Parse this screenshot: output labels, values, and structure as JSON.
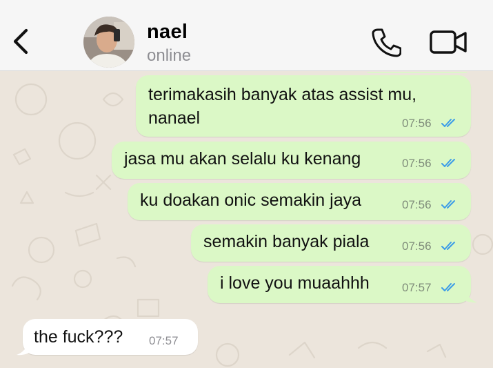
{
  "header": {
    "contact_name": "nael",
    "contact_status": "online",
    "back_icon": "chevron-left-icon",
    "call_icon": "phone-icon",
    "video_icon": "video-camera-icon"
  },
  "colors": {
    "header_bg": "#f6f6f6",
    "chat_bg": "#ece5dc",
    "outgoing_bubble": "#dbf8c6",
    "incoming_bubble": "#ffffff",
    "read_ticks": "#3a9be8"
  },
  "messages": [
    {
      "direction": "outgoing",
      "lines": [
        "terimakasih banyak atas assist mu,",
        "nanael"
      ],
      "time": "07:56",
      "status": "read"
    },
    {
      "direction": "outgoing",
      "lines": [
        "jasa mu akan selalu ku kenang"
      ],
      "time": "07:56",
      "status": "read"
    },
    {
      "direction": "outgoing",
      "lines": [
        "ku doakan onic semakin jaya"
      ],
      "time": "07:56",
      "status": "read"
    },
    {
      "direction": "outgoing",
      "lines": [
        "semakin banyak piala"
      ],
      "time": "07:56",
      "status": "read"
    },
    {
      "direction": "outgoing",
      "lines": [
        "i love you muaahhh"
      ],
      "time": "07:57",
      "status": "read"
    },
    {
      "direction": "incoming",
      "lines": [
        "the fuck???"
      ],
      "time": "07:57"
    }
  ]
}
